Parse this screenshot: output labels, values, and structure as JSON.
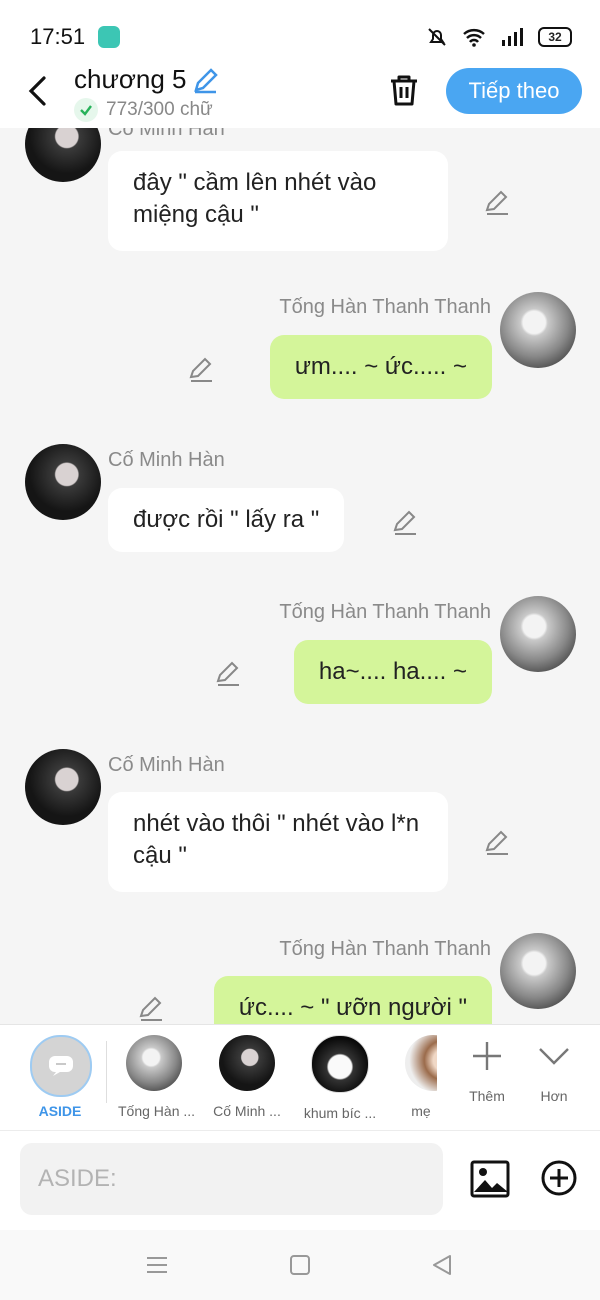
{
  "status": {
    "time": "17:51",
    "battery": "32"
  },
  "header": {
    "title": "chương 5",
    "word_count": "773/300 chữ",
    "next_label": "Tiếp theo"
  },
  "messages": [
    {
      "name": "Cố Minh Hàn",
      "text": "đây \" cầm lên nhét vào miệng cậu \""
    },
    {
      "name": "Tống Hàn Thanh Thanh",
      "text": "ưm.... ~ ức..... ~"
    },
    {
      "name": "Cố Minh Hàn",
      "text": "được rồi \" lấy ra \""
    },
    {
      "name": "Tống Hàn Thanh Thanh",
      "text": "ha~.... ha.... ~"
    },
    {
      "name": "Cố Minh Hàn",
      "text": "nhét vào thôi \" nhét vào l*n cậu \""
    },
    {
      "name": "Tống Hàn Thanh Thanh",
      "text": "ức.... ~ \" ưỡn người \""
    }
  ],
  "characters": {
    "aside_label": "ASIDE",
    "items": [
      {
        "label": "Tống Hàn ..."
      },
      {
        "label": "Cố Minh ..."
      },
      {
        "label": "khum bíc ..."
      },
      {
        "label": "mẹ"
      }
    ],
    "add_label": "Thêm",
    "more_label": "Hơn"
  },
  "input": {
    "placeholder": "ASIDE:"
  }
}
